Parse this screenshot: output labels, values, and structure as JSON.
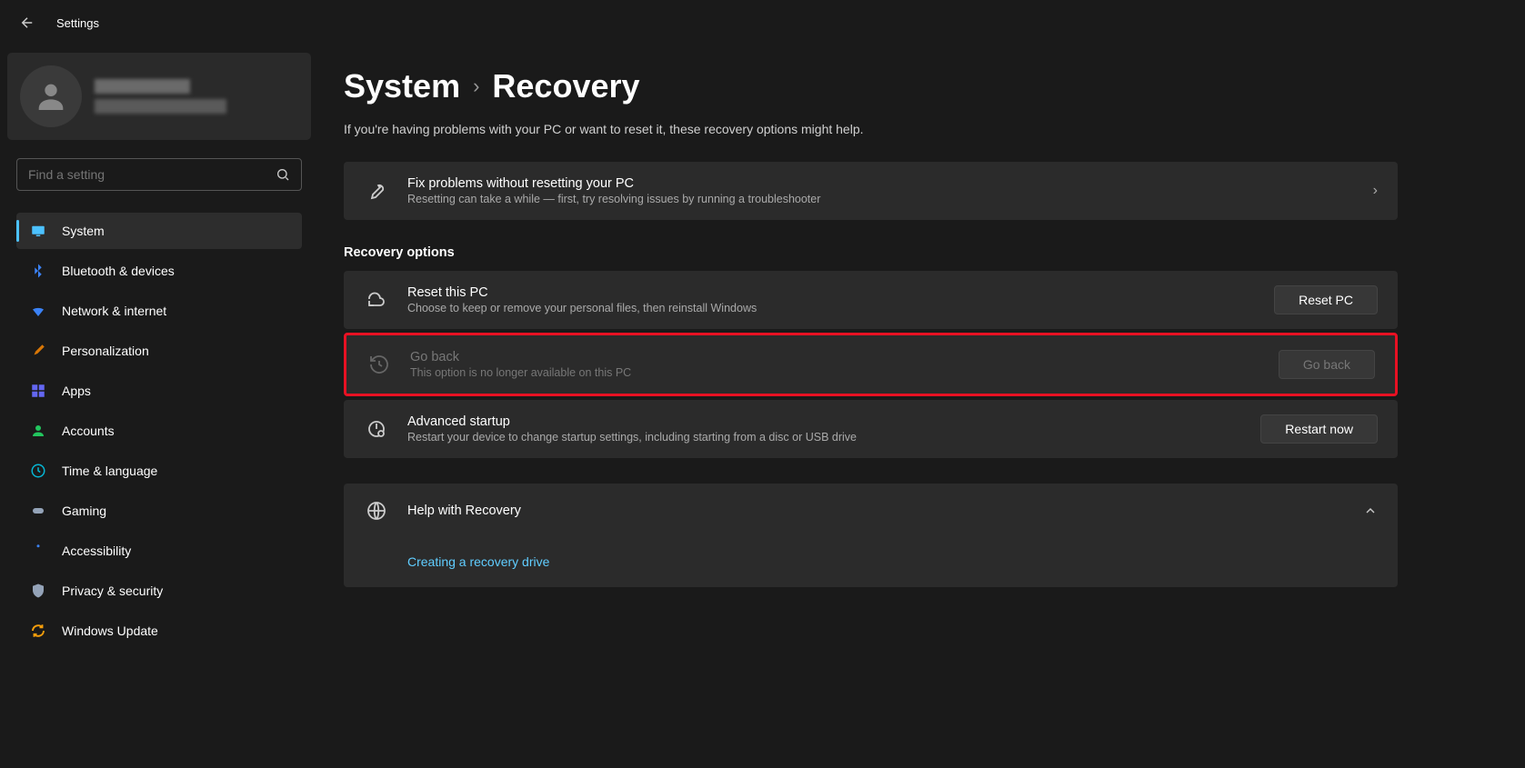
{
  "app_title": "Settings",
  "search": {
    "placeholder": "Find a setting"
  },
  "profile": {
    "name_hidden": true,
    "email_hidden": true
  },
  "sidebar": {
    "items": [
      {
        "label": "System",
        "icon": "monitor",
        "active": true
      },
      {
        "label": "Bluetooth & devices",
        "icon": "bluetooth"
      },
      {
        "label": "Network & internet",
        "icon": "wifi"
      },
      {
        "label": "Personalization",
        "icon": "brush"
      },
      {
        "label": "Apps",
        "icon": "apps"
      },
      {
        "label": "Accounts",
        "icon": "person"
      },
      {
        "label": "Time & language",
        "icon": "clock"
      },
      {
        "label": "Gaming",
        "icon": "gamepad"
      },
      {
        "label": "Accessibility",
        "icon": "accessibility"
      },
      {
        "label": "Privacy & security",
        "icon": "shield"
      },
      {
        "label": "Windows Update",
        "icon": "update"
      }
    ]
  },
  "breadcrumb": {
    "parent": "System",
    "current": "Recovery"
  },
  "page_description": "If you're having problems with your PC or want to reset it, these recovery options might help.",
  "cards": {
    "troubleshoot": {
      "title": "Fix problems without resetting your PC",
      "subtitle": "Resetting can take a while — first, try resolving issues by running a troubleshooter"
    },
    "section_title": "Recovery options",
    "reset": {
      "title": "Reset this PC",
      "subtitle": "Choose to keep or remove your personal files, then reinstall Windows",
      "button": "Reset PC"
    },
    "goback": {
      "title": "Go back",
      "subtitle": "This option is no longer available on this PC",
      "button": "Go back"
    },
    "advanced": {
      "title": "Advanced startup",
      "subtitle": "Restart your device to change startup settings, including starting from a disc or USB drive",
      "button": "Restart now"
    },
    "help": {
      "title": "Help with Recovery",
      "link": "Creating a recovery drive"
    }
  }
}
